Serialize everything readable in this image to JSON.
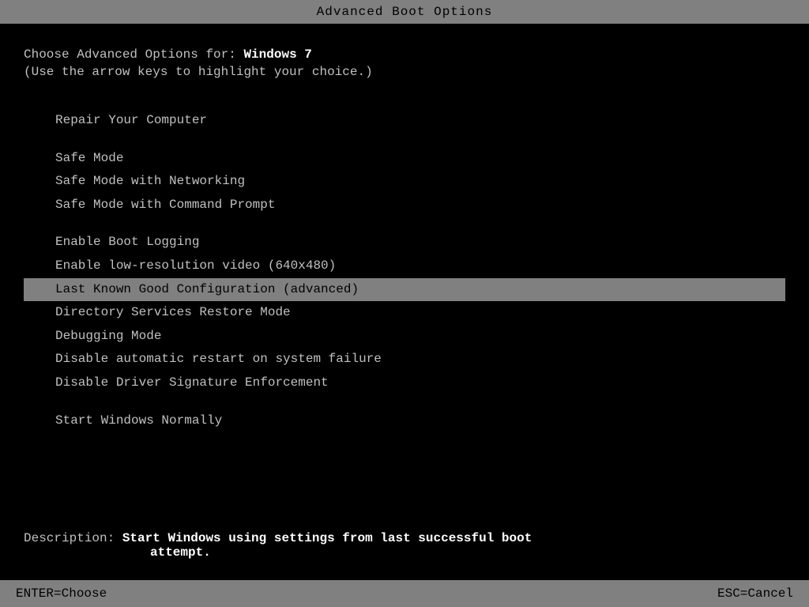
{
  "titleBar": {
    "text": "Advanced Boot Options"
  },
  "header": {
    "line1_prefix": "Choose Advanced Options for: ",
    "line1_highlight": "Windows 7",
    "line2": "(Use the arrow keys to highlight your choice.)"
  },
  "menuItems": [
    {
      "id": "repair",
      "label": "Repair Your Computer",
      "selected": false,
      "spacerBefore": true
    },
    {
      "id": "safe-mode",
      "label": "Safe Mode",
      "selected": false,
      "spacerBefore": true
    },
    {
      "id": "safe-mode-networking",
      "label": "Safe Mode with Networking",
      "selected": false,
      "spacerBefore": false
    },
    {
      "id": "safe-mode-command-prompt",
      "label": "Safe Mode with Command Prompt",
      "selected": false,
      "spacerBefore": false
    },
    {
      "id": "enable-boot-logging",
      "label": "Enable Boot Logging",
      "selected": false,
      "spacerBefore": true
    },
    {
      "id": "enable-low-res-video",
      "label": "Enable low-resolution video (640x480)",
      "selected": false,
      "spacerBefore": false
    },
    {
      "id": "last-known-good",
      "label": "Last Known Good Configuration (advanced)",
      "selected": true,
      "spacerBefore": false
    },
    {
      "id": "directory-services",
      "label": "Directory Services Restore Mode",
      "selected": false,
      "spacerBefore": false
    },
    {
      "id": "debugging-mode",
      "label": "Debugging Mode",
      "selected": false,
      "spacerBefore": false
    },
    {
      "id": "disable-restart",
      "label": "Disable automatic restart on system failure",
      "selected": false,
      "spacerBefore": false
    },
    {
      "id": "disable-driver-sig",
      "label": "Disable Driver Signature Enforcement",
      "selected": false,
      "spacerBefore": false
    },
    {
      "id": "start-windows-normally",
      "label": "Start Windows Normally",
      "selected": false,
      "spacerBefore": true
    }
  ],
  "description": {
    "label": "Description: ",
    "text": "Start Windows using settings from last successful boot",
    "continuation": "attempt."
  },
  "bottomBar": {
    "enter": "ENTER=Choose",
    "esc": "ESC=Cancel"
  }
}
